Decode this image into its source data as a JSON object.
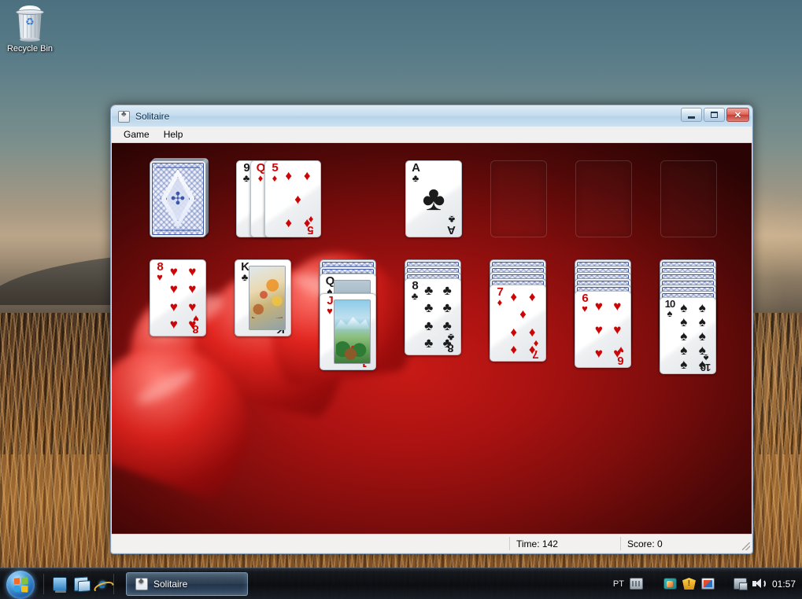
{
  "desktop": {
    "icons": [
      {
        "name": "recycle-bin",
        "label": "Recycle Bin"
      }
    ]
  },
  "window": {
    "title": "Solitaire",
    "icon": "cards-icon",
    "controls": {
      "minimize_label": "Minimize",
      "maximize_label": "Maximize",
      "close_label": "✕"
    },
    "menu": [
      {
        "label": "Game"
      },
      {
        "label": "Help"
      }
    ],
    "statusbar": {
      "time_label": "Time: 142",
      "score_label": "Score: 0"
    }
  },
  "game": {
    "table_color": "#a91211",
    "stock": {
      "name": "stock-pile",
      "face_down_count": 4,
      "empty": false
    },
    "waste": {
      "name": "waste-pile",
      "cards": [
        {
          "rank": "9",
          "suit": "♣",
          "color": "black"
        },
        {
          "rank": "Q",
          "suit": "♦",
          "color": "red"
        },
        {
          "rank": "5",
          "suit": "♦",
          "color": "red"
        }
      ]
    },
    "foundations": [
      {
        "name": "foundation-clubs",
        "empty": false,
        "rank": "A",
        "suit": "♣",
        "color": "black"
      },
      {
        "name": "foundation-2",
        "empty": true
      },
      {
        "name": "foundation-3",
        "empty": true
      },
      {
        "name": "foundation-4",
        "empty": true
      }
    ],
    "tableau": [
      {
        "name": "tableau-column-1",
        "face_down": 0,
        "face_up": [
          {
            "rank": "8",
            "suit": "♥",
            "color": "red"
          }
        ]
      },
      {
        "name": "tableau-column-2",
        "face_down": 0,
        "face_up": [
          {
            "rank": "K",
            "suit": "♣",
            "color": "black",
            "court": "king"
          }
        ]
      },
      {
        "name": "tableau-column-3",
        "face_down": 2,
        "face_up": [
          {
            "rank": "Q",
            "suit": "♠",
            "color": "black",
            "court": "queen"
          },
          {
            "rank": "J",
            "suit": "♥",
            "color": "red",
            "court": "jack"
          }
        ]
      },
      {
        "name": "tableau-column-4",
        "face_down": 3,
        "face_up": [
          {
            "rank": "8",
            "suit": "♣",
            "color": "black"
          }
        ]
      },
      {
        "name": "tableau-column-5",
        "face_down": 4,
        "face_up": [
          {
            "rank": "7",
            "suit": "♦",
            "color": "red"
          }
        ]
      },
      {
        "name": "tableau-column-6",
        "face_down": 5,
        "face_up": [
          {
            "rank": "6",
            "suit": "♥",
            "color": "red"
          }
        ]
      },
      {
        "name": "tableau-column-7",
        "face_down": 6,
        "face_up": [
          {
            "rank": "10",
            "suit": "♠",
            "color": "black"
          }
        ]
      }
    ]
  },
  "taskbar": {
    "start_label": "Start",
    "quick_launch": [
      {
        "name": "show-desktop-icon",
        "label": "Show desktop"
      },
      {
        "name": "switch-windows-icon",
        "label": "Switch between windows"
      },
      {
        "name": "internet-explorer-icon",
        "label": "Internet Explorer"
      }
    ],
    "tasks": [
      {
        "name": "taskbar-button-solitaire",
        "label": "Solitaire",
        "active": true
      }
    ],
    "tray": {
      "language": "PT",
      "icons": [
        {
          "name": "keyboard-icon"
        },
        {
          "name": "paint-tray-icon"
        },
        {
          "name": "security-shield-icon"
        },
        {
          "name": "application-tray-icon"
        },
        {
          "name": "network-icon"
        },
        {
          "name": "volume-icon"
        }
      ],
      "clock": "01:57"
    }
  }
}
